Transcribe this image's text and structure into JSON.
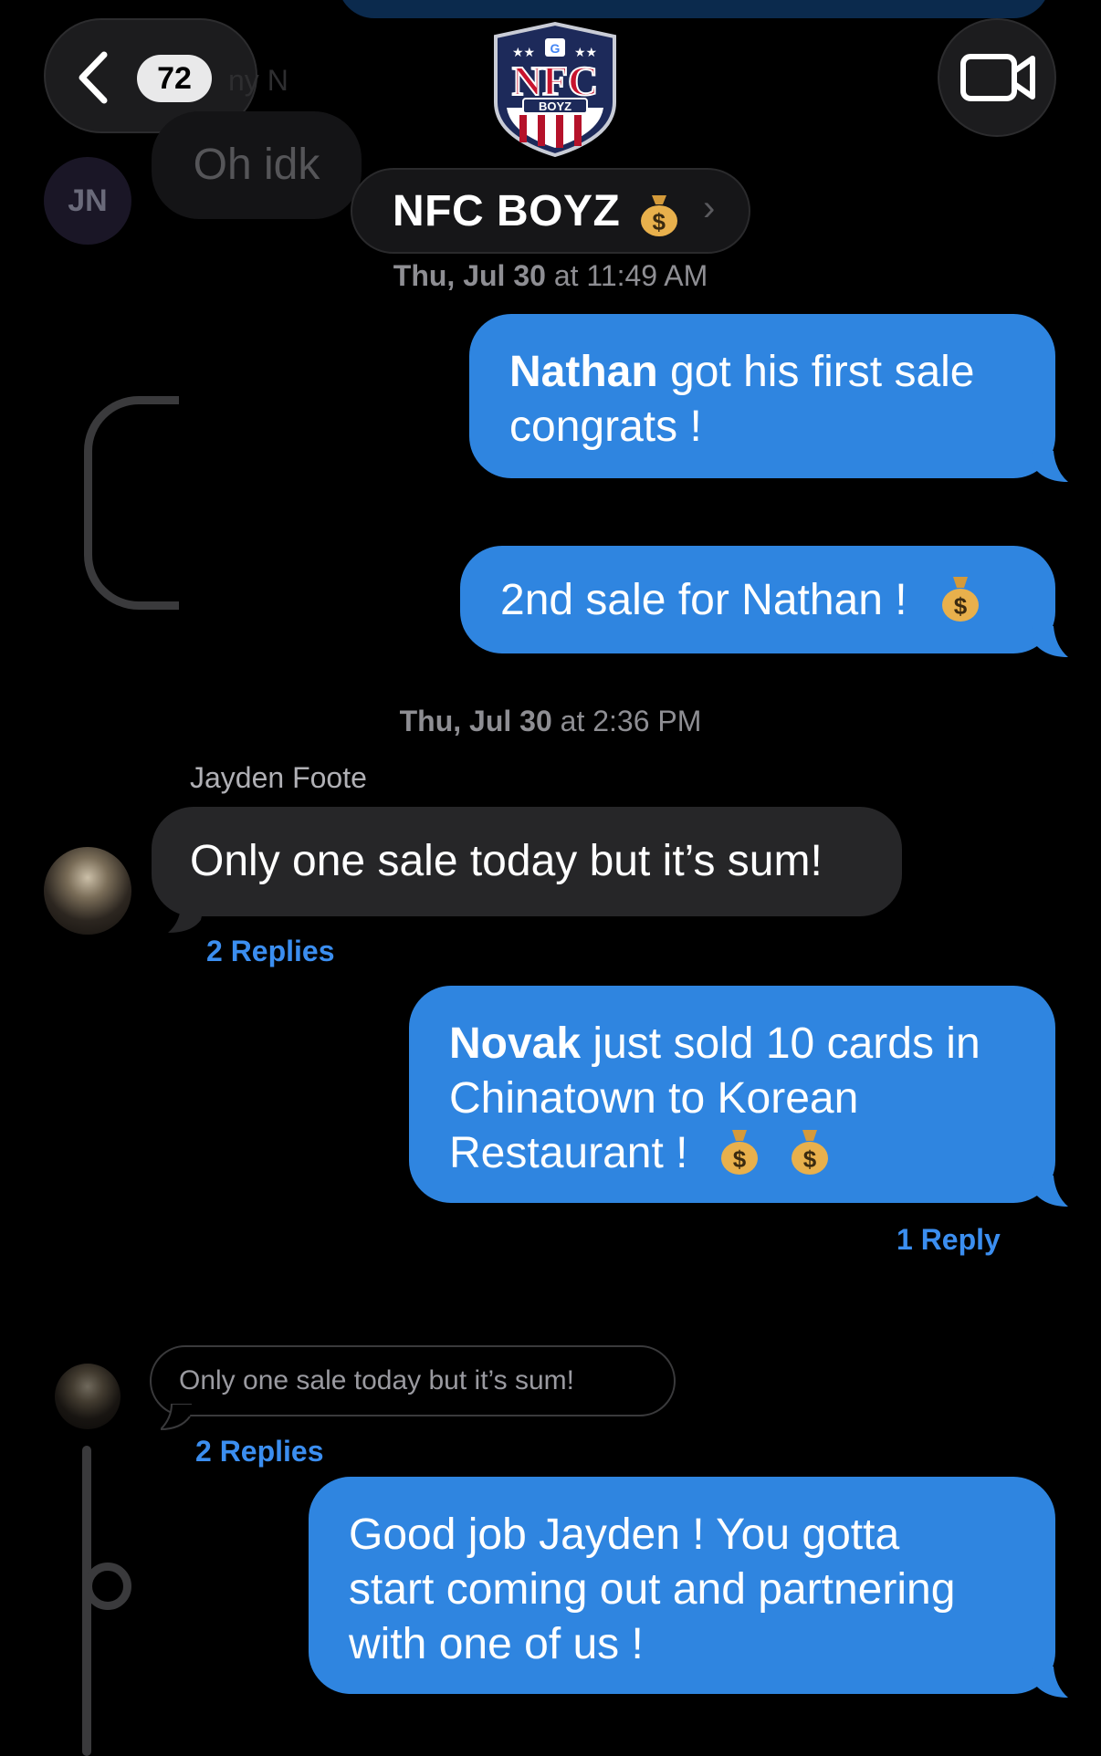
{
  "header": {
    "back_badge": "72",
    "faded_sender_name": "ny N",
    "group_name": "NFC BOYZ",
    "group_chevron": "›",
    "logo_text_main": "NFC",
    "logo_text_sub": "BOYZ",
    "icons": [
      "chevron-left-icon",
      "video-camera-icon",
      "money-bag-icon"
    ]
  },
  "faded_message": {
    "avatar_initials": "JN",
    "text": "Oh idk"
  },
  "timestamps": {
    "t1_day": "Thu, Jul 30",
    "t1_rest": " at 11:49 AM",
    "t2_day": "Thu, Jul 30",
    "t2_rest": " at 2:36 PM"
  },
  "messages": {
    "m1_bold": "Nathan",
    "m1_text": " got his first sale",
    "m1_text2": "congrats !",
    "m2_text": "2nd sale for Nathan !",
    "jayden_sender": "Jayden Foote",
    "m3_text": "Only one sale today but it’s sum!",
    "m3_replies": "2 Replies",
    "m4_bold": "Novak",
    "m4_text": " just sold 10 cards in",
    "m4_text2": "Chinatown to Korean",
    "m4_text3": "Restaurant !",
    "m4_replies": "1 Reply",
    "quoted_text": "Only one sale today but it’s sum!",
    "quoted_replies": "2 Replies",
    "m5_line1": "Good job Jayden ! You gotta",
    "m5_line2": "start coming out and partnering",
    "m5_line3": "with one of us !"
  },
  "colors": {
    "outgoing_bubble": "#2f85e0",
    "incoming_bubble": "#262628",
    "reply_link": "#3b8ef0",
    "background": "#000000"
  }
}
